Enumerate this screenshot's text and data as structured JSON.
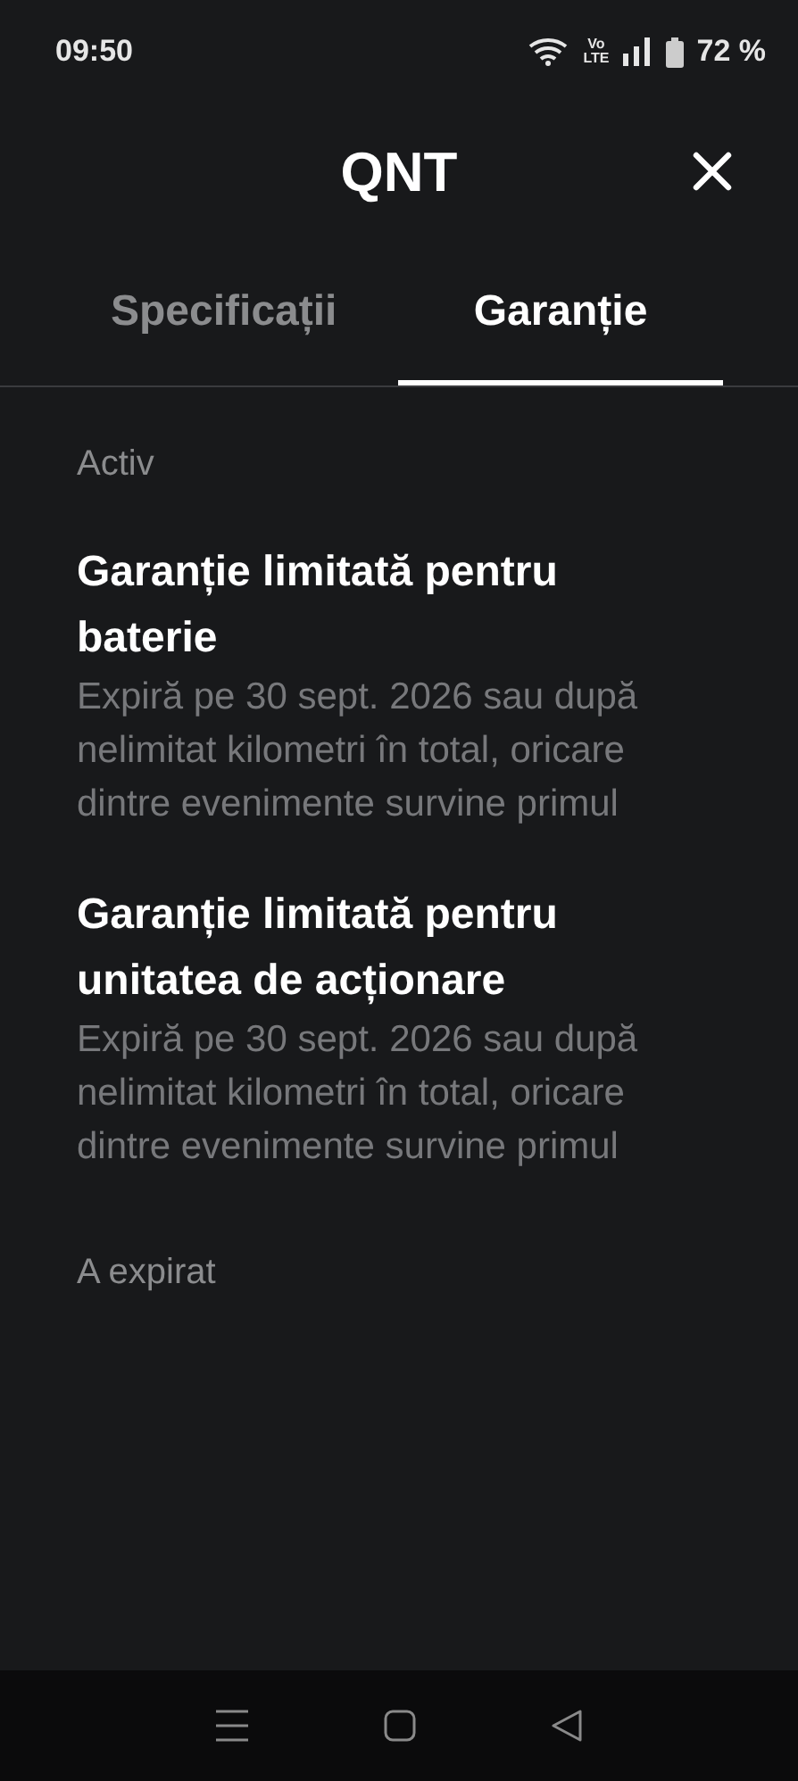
{
  "status_bar": {
    "time": "09:50",
    "network": "Vo\nLTE",
    "battery": "72 %"
  },
  "header": {
    "title": "QNT"
  },
  "tabs": [
    {
      "label": "Specificații",
      "selected": false
    },
    {
      "label": "Garanție",
      "selected": true
    }
  ],
  "sections": [
    {
      "heading": "Activ",
      "items": [
        {
          "title": "Garanție limitată pentru baterie",
          "description": "Expiră pe 30 sept. 2026 sau după nelimitat kilometri în total, oricare dintre evenimente survine primul"
        },
        {
          "title": "Garanție limitată pentru unitatea de acționare",
          "description": "Expiră pe 30 sept. 2026 sau după nelimitat kilometri în total, oricare dintre evenimente survine primul"
        }
      ]
    },
    {
      "heading": "A expirat"
    }
  ]
}
